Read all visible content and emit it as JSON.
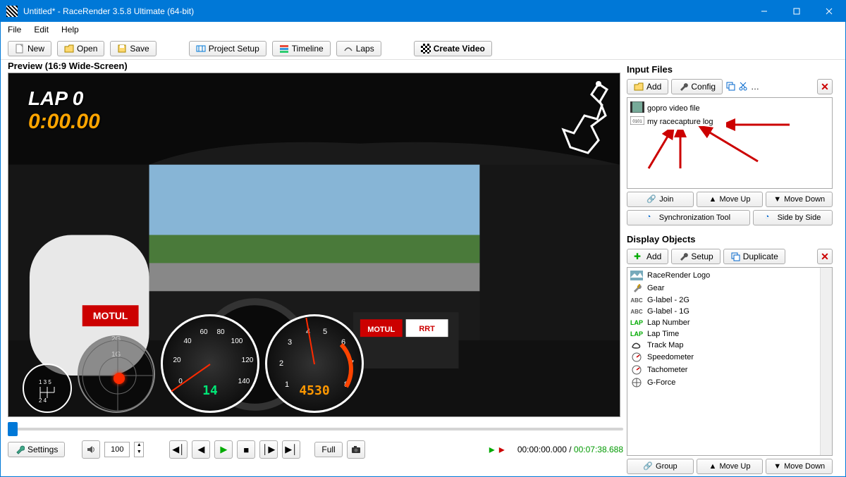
{
  "titlebar": {
    "title": "Untitled* - RaceRender 3.5.8 Ultimate (64-bit)"
  },
  "menu": {
    "file": "File",
    "edit": "Edit",
    "help": "Help"
  },
  "toolbar": {
    "new": "New",
    "open": "Open",
    "save": "Save",
    "project_setup": "Project Setup",
    "timeline": "Timeline",
    "laps": "Laps",
    "create_video": "Create Video"
  },
  "preview": {
    "label": "Preview (16:9 Wide-Screen)",
    "lap": "LAP 0",
    "time": "0:00.00",
    "speed_value": "14",
    "rpm_value": "4530",
    "gforce_labels": {
      "g1": "1G",
      "g2": "2G"
    },
    "gear_grid": "1 3 5\n2 4"
  },
  "playback": {
    "settings": "Settings",
    "volume": "100",
    "full": "Full",
    "time_current": "00:00:00.000",
    "time_separator": " / ",
    "time_total": "00:07:38.688"
  },
  "input_files": {
    "title": "Input Files",
    "add": "Add",
    "config": "Config",
    "join": "Join",
    "move_up": "Move Up",
    "move_down": "Move Down",
    "sync_tool": "Synchronization Tool",
    "side_by_side": "Side by Side",
    "items": [
      {
        "label": "gopro video file"
      },
      {
        "label": "my racecapture log"
      }
    ]
  },
  "display_objects": {
    "title": "Display Objects",
    "add": "Add",
    "setup": "Setup",
    "duplicate": "Duplicate",
    "group": "Group",
    "move_up": "Move Up",
    "move_down": "Move Down",
    "items": [
      {
        "type": "logo",
        "label": "RaceRender Logo"
      },
      {
        "type": "gear",
        "label": "Gear"
      },
      {
        "type": "abc",
        "label": "G-label - 2G"
      },
      {
        "type": "abc",
        "label": "G-label - 1G"
      },
      {
        "type": "lap",
        "label": "Lap Number"
      },
      {
        "type": "lap",
        "label": "Lap Time"
      },
      {
        "type": "track",
        "label": "Track Map"
      },
      {
        "type": "gauge",
        "label": "Speedometer"
      },
      {
        "type": "gauge",
        "label": "Tachometer"
      },
      {
        "type": "gforce",
        "label": "G-Force"
      }
    ]
  }
}
